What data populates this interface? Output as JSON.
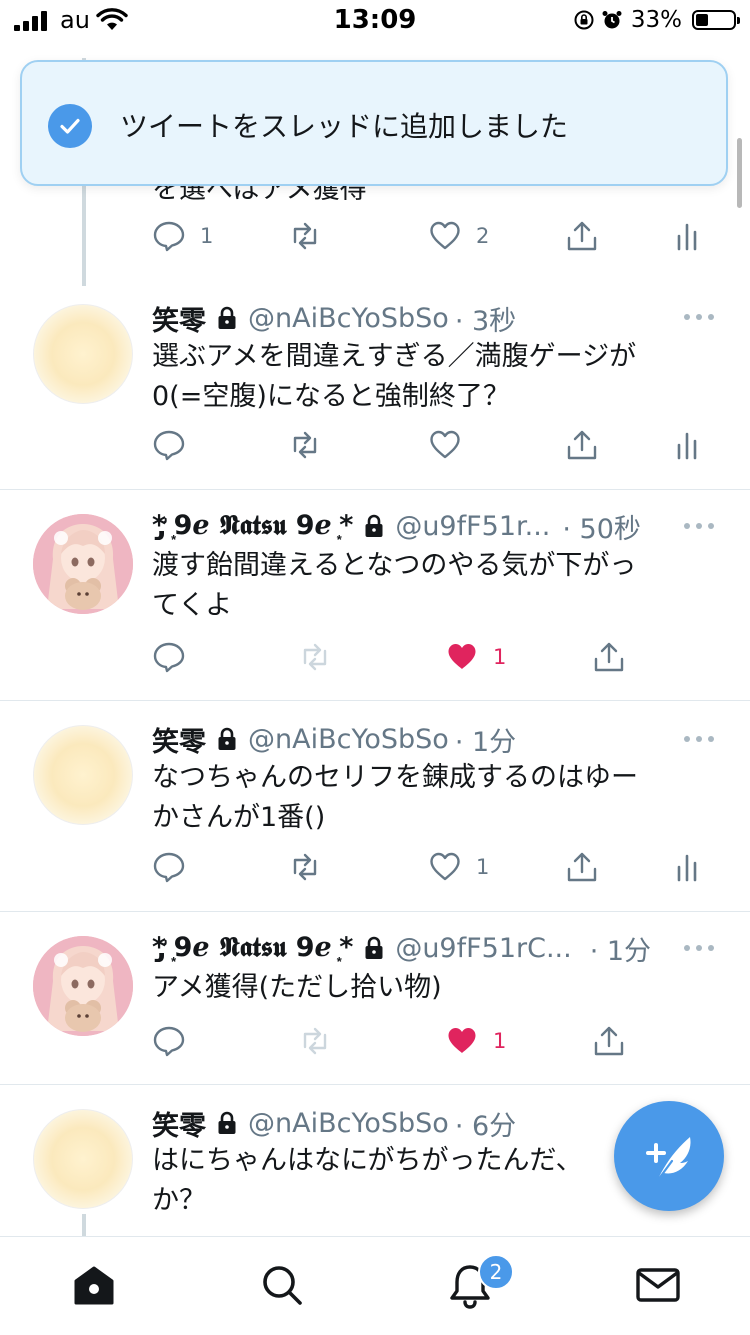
{
  "status_bar": {
    "carrier": "au",
    "time": "13:09",
    "battery_percent": "33%"
  },
  "toast": {
    "message": "ツイートをスレッドに追加しました"
  },
  "partial_tweet": {
    "text_fragment": "を選べばアメ獲得",
    "reply_count": "1",
    "like_count": "2"
  },
  "tweets": [
    {
      "name": "笑零",
      "handle": "@nAiBcYoSbSo",
      "time": "· 3秒",
      "text": "選ぶアメを間違えすぎる／満腹ゲージが\n0(=空腹)になると強制終了？",
      "reply_count": "",
      "retweet_count": "",
      "like_count": "",
      "liked": false
    },
    {
      "name": "*̡̛ ͙9ℯ 𝕹𝖆𝖙𝖘𝖚 9ℯ ͙*",
      "handle": "@u9fF51r...",
      "time": "· 50秒",
      "text": "渡す飴間違えるとなつのやる気が下がっ\nてくよ",
      "reply_count": "",
      "retweet_count": "",
      "like_count": "1",
      "liked": true
    },
    {
      "name": "笑零",
      "handle": "@nAiBcYoSbSo",
      "time": "· 1分",
      "text": "なつちゃんのセリフを錬成するのはゆー\nかさんが1番()",
      "reply_count": "",
      "retweet_count": "",
      "like_count": "1",
      "liked": false
    },
    {
      "name": "*̡̛ ͙9ℯ 𝕹𝖆𝖙𝖘𝖚 9ℯ ͙*",
      "handle": "@u9fF51rC...",
      "time": "· 1分",
      "text": "アメ獲得(ただし拾い物)",
      "reply_count": "",
      "retweet_count": "",
      "like_count": "1",
      "liked": true
    },
    {
      "name": "笑零",
      "handle": "@nAiBcYoSbSo",
      "time": "· 6分",
      "text": "はにちゃんはなにがちがったんだ、\nか？",
      "reply_count": "",
      "retweet_count": "",
      "like_count": "",
      "liked": false
    }
  ],
  "tab_bar": {
    "notification_badge": "2"
  },
  "colors": {
    "accent": "#4a99e9",
    "like_red": "#e0245e",
    "muted": "#657786"
  }
}
